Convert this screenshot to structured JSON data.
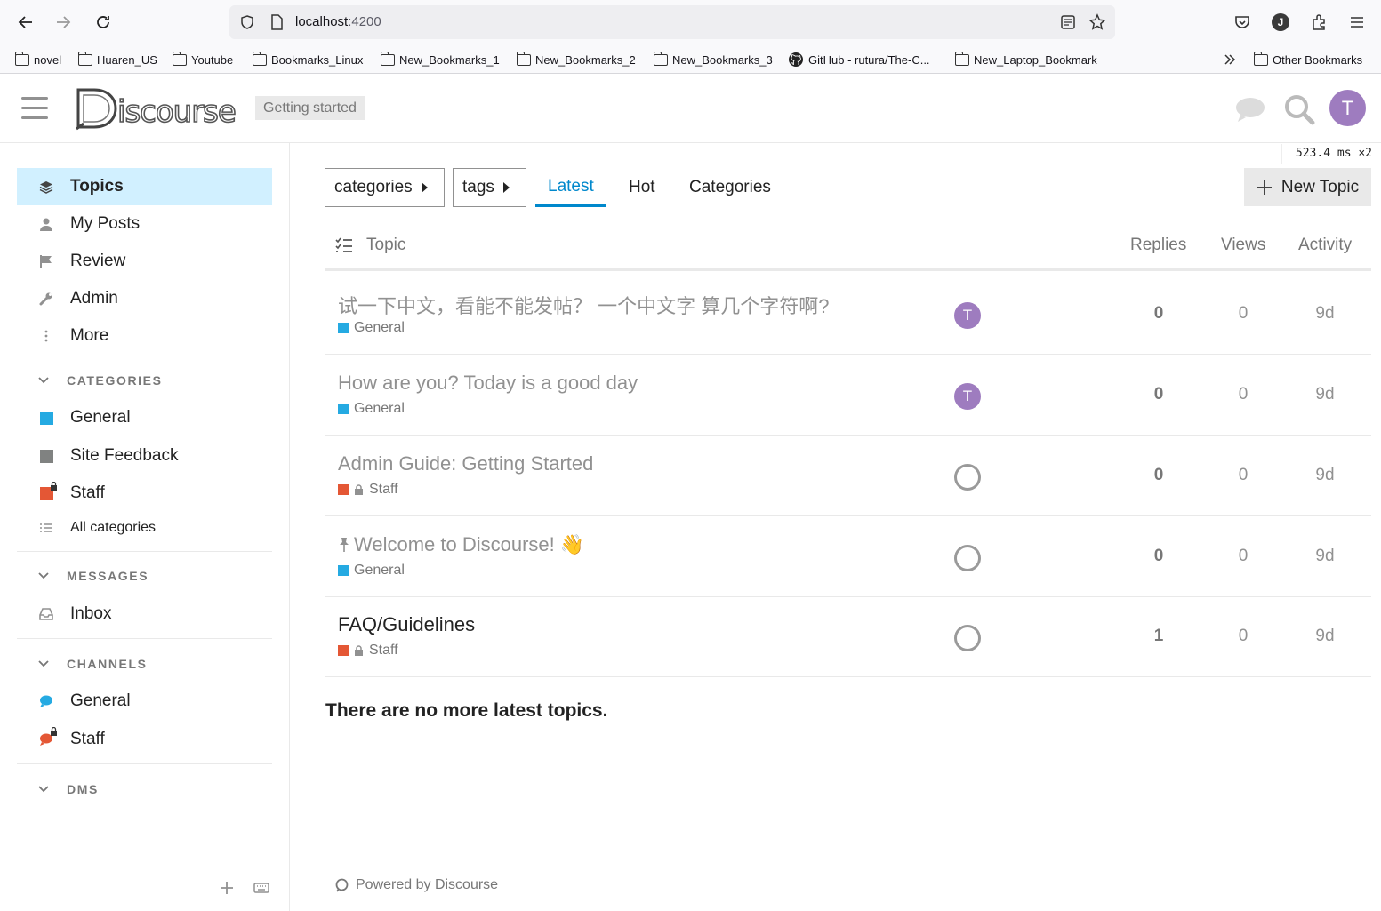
{
  "browser": {
    "url_host": "localhost",
    "url_port": ":4200",
    "bookmarks": [
      {
        "label": "novel"
      },
      {
        "label": "Huaren_US"
      },
      {
        "label": "Youtube"
      },
      {
        "label": "Bookmarks_Linux"
      },
      {
        "label": "New_Bookmarks_1"
      },
      {
        "label": "New_Bookmarks_2"
      },
      {
        "label": "New_Bookmarks_3"
      },
      {
        "label": "GitHub - rutura/The-C..."
      },
      {
        "label": "New_Laptop_Bookmark"
      }
    ],
    "other_bookmarks": "Other Bookmarks",
    "profile_initial": "J"
  },
  "header": {
    "site_banner": "Getting started",
    "user_initial": "T",
    "perf": "523.4 ms ×2"
  },
  "sidebar": {
    "primary": [
      {
        "label": "Topics",
        "icon": "layers-icon"
      },
      {
        "label": "My Posts",
        "icon": "user-icon"
      },
      {
        "label": "Review",
        "icon": "flag-icon"
      },
      {
        "label": "Admin",
        "icon": "wrench-icon"
      },
      {
        "label": "More",
        "icon": "more-vertical-icon"
      }
    ],
    "categories_heading": "CATEGORIES",
    "categories": [
      {
        "label": "General",
        "color": "#25AAE2"
      },
      {
        "label": "Site Feedback",
        "color": "#808281"
      },
      {
        "label": "Staff",
        "color": "#E45735"
      }
    ],
    "all_categories": "All categories",
    "messages_heading": "MESSAGES",
    "inbox": "Inbox",
    "channels_heading": "CHANNELS",
    "channels": [
      {
        "label": "General",
        "color": "#25AAE2"
      },
      {
        "label": "Staff",
        "color": "#E45735"
      }
    ],
    "dms_heading": "DMS"
  },
  "nav": {
    "categories_dropdown": "categories",
    "tags_dropdown": "tags",
    "tabs": [
      "Latest",
      "Hot",
      "Categories"
    ],
    "new_topic": "New Topic"
  },
  "topic_list": {
    "columns": {
      "topic": "Topic",
      "replies": "Replies",
      "views": "Views",
      "activity": "Activity"
    },
    "topics": [
      {
        "title": "试一下中文，看能不能发帖？ 一个中文字 算几个字符啊?",
        "category": "General",
        "cat_color": "#25AAE2",
        "locked": false,
        "poster": "T",
        "replies": "0",
        "views": "0",
        "activity": "9d",
        "unread": false
      },
      {
        "title": "How are you? Today is a good day",
        "category": "General",
        "cat_color": "#25AAE2",
        "locked": false,
        "poster": "T",
        "replies": "0",
        "views": "0",
        "activity": "9d",
        "unread": false
      },
      {
        "title": "Admin Guide: Getting Started",
        "category": "Staff",
        "cat_color": "#E45735",
        "locked": true,
        "poster": "",
        "replies": "0",
        "views": "0",
        "activity": "9d",
        "unread": false
      },
      {
        "title": "Welcome to Discourse! 👋",
        "category": "General",
        "cat_color": "#25AAE2",
        "locked": false,
        "poster": "",
        "replies": "0",
        "views": "0",
        "activity": "9d",
        "unread": false,
        "pinned": true
      },
      {
        "title": "FAQ/Guidelines",
        "category": "Staff",
        "cat_color": "#E45735",
        "locked": true,
        "poster": "",
        "replies": "1",
        "views": "0",
        "activity": "9d",
        "unread": true
      }
    ],
    "footer_message": "There are no more latest topics."
  },
  "footer": {
    "powered_by": "Powered by Discourse"
  }
}
